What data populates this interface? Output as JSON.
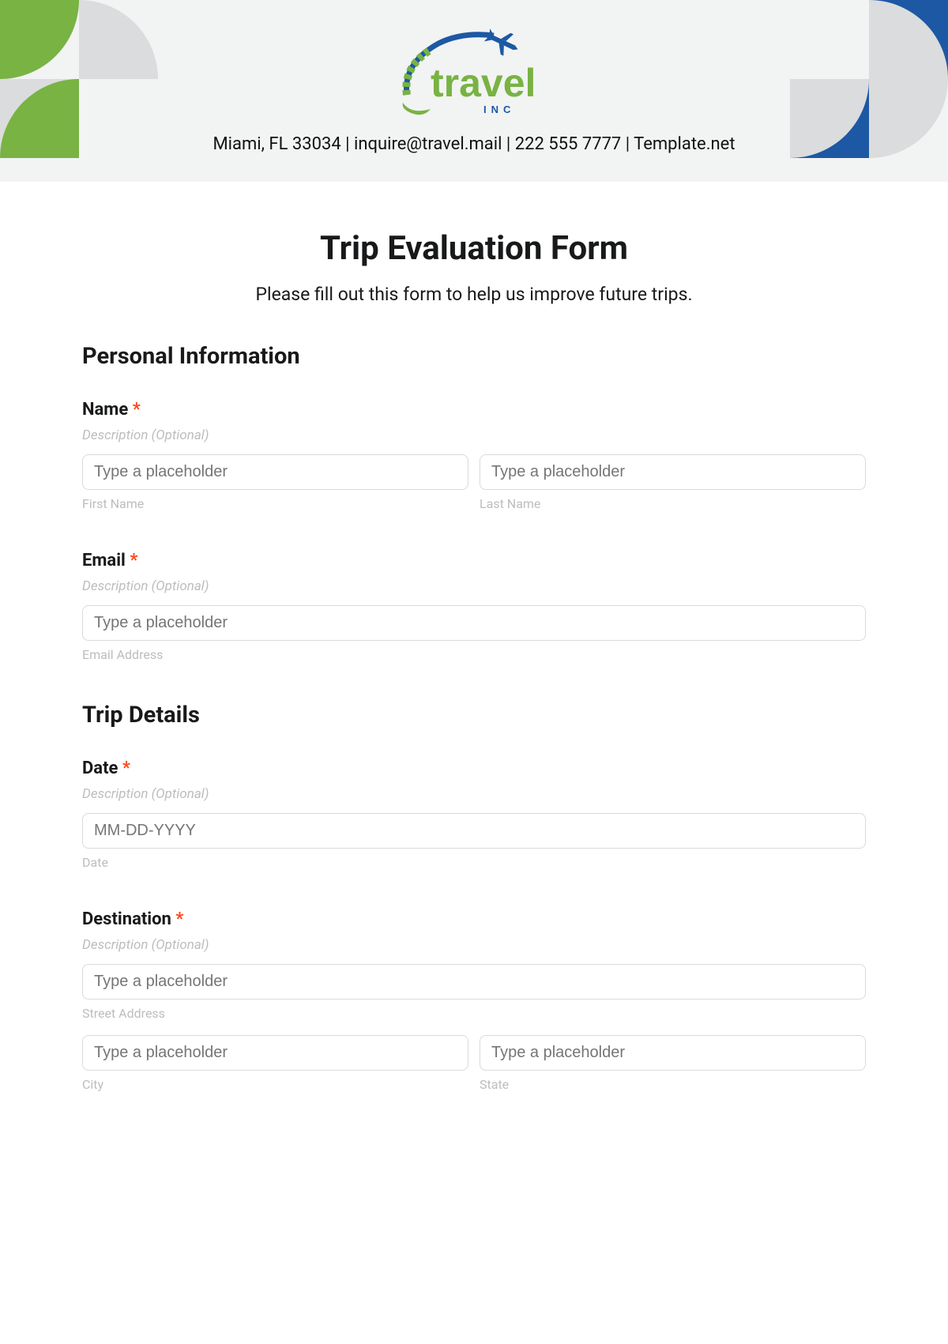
{
  "header": {
    "logo_text": "travel",
    "logo_sub": "I N C",
    "contact": "Miami, FL 33034 | inquire@travel.mail | 222 555 7777 | Template.net"
  },
  "form": {
    "title": "Trip Evaluation Form",
    "subtitle": "Please fill out this form to help us improve future trips."
  },
  "sections": {
    "personal": {
      "title": "Personal Information",
      "name": {
        "label": "Name",
        "required": "*",
        "description": "Description (Optional)",
        "first_placeholder": "Type a placeholder",
        "last_placeholder": "Type a placeholder",
        "first_sub": "First Name",
        "last_sub": "Last Name"
      },
      "email": {
        "label": "Email",
        "required": "*",
        "description": "Description (Optional)",
        "placeholder": "Type a placeholder",
        "sub": "Email Address"
      }
    },
    "trip": {
      "title": "Trip Details",
      "date": {
        "label": "Date",
        "required": "*",
        "description": "Description (Optional)",
        "placeholder": "MM-DD-YYYY",
        "sub": "Date"
      },
      "destination": {
        "label": "Destination",
        "required": "*",
        "description": "Description (Optional)",
        "street_placeholder": "Type a placeholder",
        "street_sub": "Street Address",
        "city_placeholder": "Type a placeholder",
        "state_placeholder": "Type a placeholder",
        "city_sub": "City",
        "state_sub": "State"
      }
    }
  }
}
